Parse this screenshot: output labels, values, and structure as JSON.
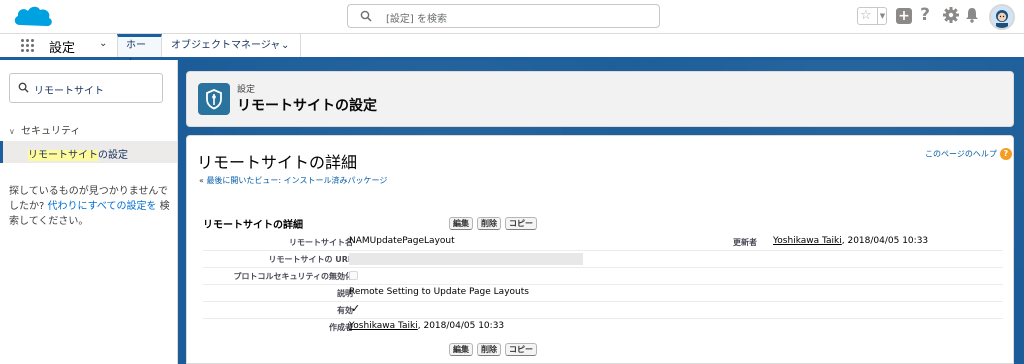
{
  "header": {
    "search_placeholder": "[設定] を検索",
    "icons": [
      "salesforce-cloud-logo",
      "search-icon",
      "favorites-star-icon",
      "chevron-down-icon",
      "add-icon",
      "help-icon",
      "setup-gear-icon",
      "notifications-bell-icon",
      "user-avatar"
    ]
  },
  "nav": {
    "app_name": "設定",
    "tabs": [
      {
        "label": "ホーム",
        "active": true
      },
      {
        "label": "オブジェクトマネージャ",
        "active": false
      }
    ]
  },
  "sidebar": {
    "search_value": "リモートサイト",
    "category": "セキュリティ",
    "item_highlight": "リモートサイト",
    "item_rest": "の設定",
    "not_found_1": "探しているものが見つかりませんでしたか? ",
    "not_found_link": "代わりにすべての設定を",
    "not_found_2": " 検索してください。"
  },
  "page_header": {
    "kicker": "設定",
    "title": "リモートサイトの設定"
  },
  "detail": {
    "title": "リモートサイトの詳細",
    "help_link": "このページのヘルプ",
    "back_prefix": "« ",
    "back_link": "最後に開いたビュー: インストール済みパッケージ",
    "section_title": "リモートサイトの詳細",
    "buttons": {
      "edit": "編集",
      "delete": "削除",
      "copy": "コピー"
    },
    "fields": {
      "name_label": "リモートサイト名",
      "name_value": "NAMUpdatePageLayout",
      "url_label": "リモートサイトの URL",
      "protocol_label": "プロトコルセキュリティの無効化",
      "desc_label": "説明",
      "desc_value": "Remote Setting to Update Page Layouts",
      "active_label": "有効",
      "active_value": "✓",
      "created_label": "作成者",
      "created_user": "Yoshikawa Taiki",
      "created_date": ", 2018/04/05 10:33",
      "modified_label": "更新者",
      "modified_user": "Yoshikawa Taiki",
      "modified_date": ", 2018/04/05 10:33"
    }
  },
  "colors": {
    "brand_blue": "#1b5f9e",
    "link": "#015ba7",
    "help_badge": "#f49d23",
    "highlight": "#fffb9c"
  }
}
